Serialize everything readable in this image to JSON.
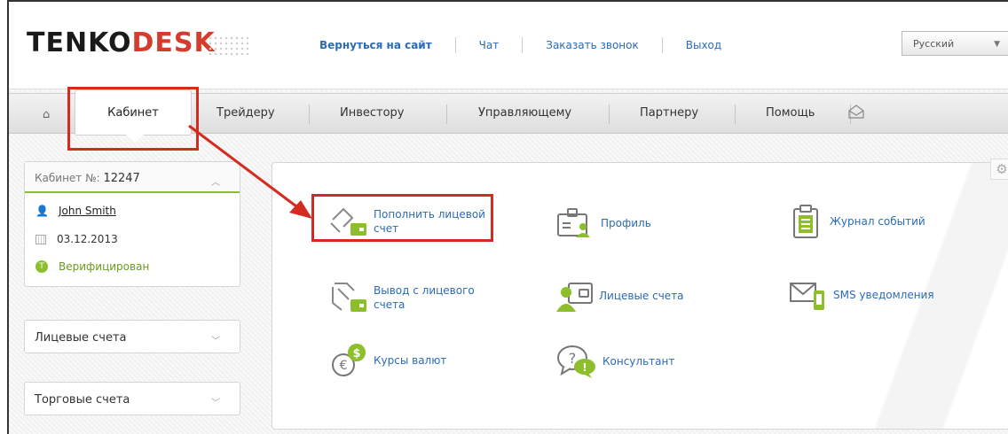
{
  "header": {
    "logo_a": "TENKO",
    "logo_b": "DESK",
    "nav": {
      "back": "Вернуться на сайт",
      "chat": "Чат",
      "callback": "Заказать звонок",
      "logout": "Выход"
    },
    "language": "Русский"
  },
  "menu": {
    "cabinet": "Кабинет",
    "trader": "Трейдеру",
    "investor": "Инвестору",
    "manager": "Управляющему",
    "partner": "Партнеру",
    "help": "Помощь"
  },
  "sidebar": {
    "cabinet_label": "Кабинет №:",
    "cabinet_number": "12247",
    "user_name": "John Smith",
    "date": "03.12.2013",
    "verified_badge": "T",
    "verified": "Верифицирован",
    "personal_accounts": "Лицевые счета",
    "trading_accounts": "Торговые счета"
  },
  "tiles": {
    "deposit_l1": "Пополнить лицевой",
    "deposit_l2": "счет",
    "profile": "Профиль",
    "event_log": "Журнал событий",
    "withdraw_l1": "Вывод с лицевого",
    "withdraw_l2": "счета",
    "personal_accounts": "Лицевые счета",
    "sms": "SMS уведомления",
    "rates": "Курсы валют",
    "consultant": "Консультант"
  },
  "colors": {
    "link": "#2b6bb5",
    "accent_green": "#8cbf2b",
    "highlight_red": "#d42a20"
  }
}
